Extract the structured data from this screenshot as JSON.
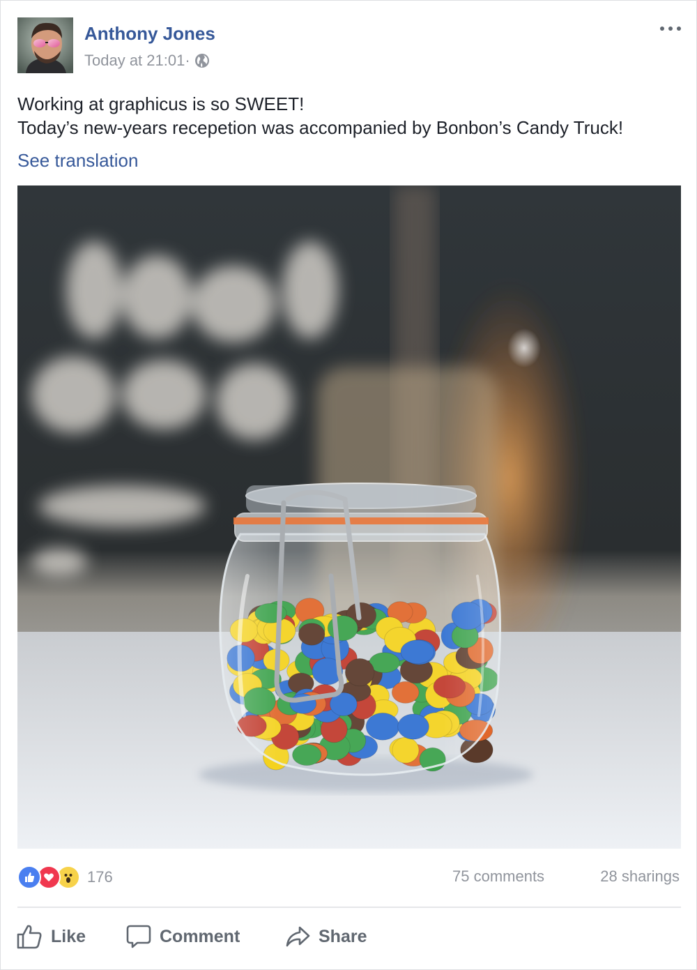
{
  "post": {
    "author": "Anthony Jones",
    "timestamp": "Today at  21:01·",
    "privacy_icon": "globe-icon",
    "more_icon": "more-options-icon",
    "text_lines": [
      "Working at graphicus is so SWEET!",
      "Today’s new-years recepetion was accompanied by Bonbon’s Candy Truck!"
    ],
    "see_translation": "See translation"
  },
  "stats": {
    "reaction_icons": [
      "like-reaction-icon",
      "love-reaction-icon",
      "wow-reaction-icon"
    ],
    "reaction_count": "176",
    "comments": "75 comments",
    "shares": "28 sharings"
  },
  "actions": {
    "like": "Like",
    "comment": "Comment",
    "share": "Share"
  },
  "colors": {
    "link_blue": "#365899",
    "meta_gray": "#90949c",
    "like_blue": "#4a7ff0",
    "love_red": "#f0384f",
    "wow_yellow": "#f7d24a"
  }
}
